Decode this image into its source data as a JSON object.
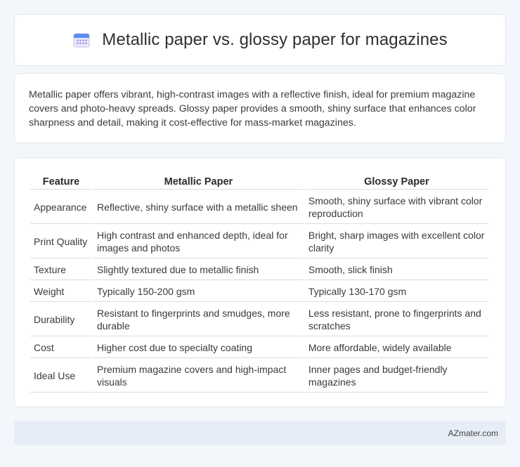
{
  "header": {
    "title": "Metallic paper vs. glossy paper for magazines",
    "icon": "calendar-icon"
  },
  "intro": {
    "text": "Metallic paper offers vibrant, high-contrast images with a reflective finish, ideal for premium magazine covers and photo-heavy spreads. Glossy paper provides a smooth, shiny surface that enhances color sharpness and detail, making it cost-effective for mass-market magazines."
  },
  "table": {
    "headers": [
      "Feature",
      "Metallic Paper",
      "Glossy Paper"
    ],
    "rows": [
      [
        "Appearance",
        "Reflective, shiny surface with a metallic sheen",
        "Smooth, shiny surface with vibrant color reproduction"
      ],
      [
        "Print Quality",
        "High contrast and enhanced depth, ideal for images and photos",
        "Bright, sharp images with excellent color clarity"
      ],
      [
        "Texture",
        "Slightly textured due to metallic finish",
        "Smooth, slick finish"
      ],
      [
        "Weight",
        "Typically 150-200 gsm",
        "Typically 130-170 gsm"
      ],
      [
        "Durability",
        "Resistant to fingerprints and smudges, more durable",
        "Less resistant, prone to fingerprints and scratches"
      ],
      [
        "Cost",
        "Higher cost due to specialty coating",
        "More affordable, widely available"
      ],
      [
        "Ideal Use",
        "Premium magazine covers and high-impact visuals",
        "Inner pages and budget-friendly magazines"
      ]
    ]
  },
  "footer": {
    "brand": "AZmater.com"
  }
}
